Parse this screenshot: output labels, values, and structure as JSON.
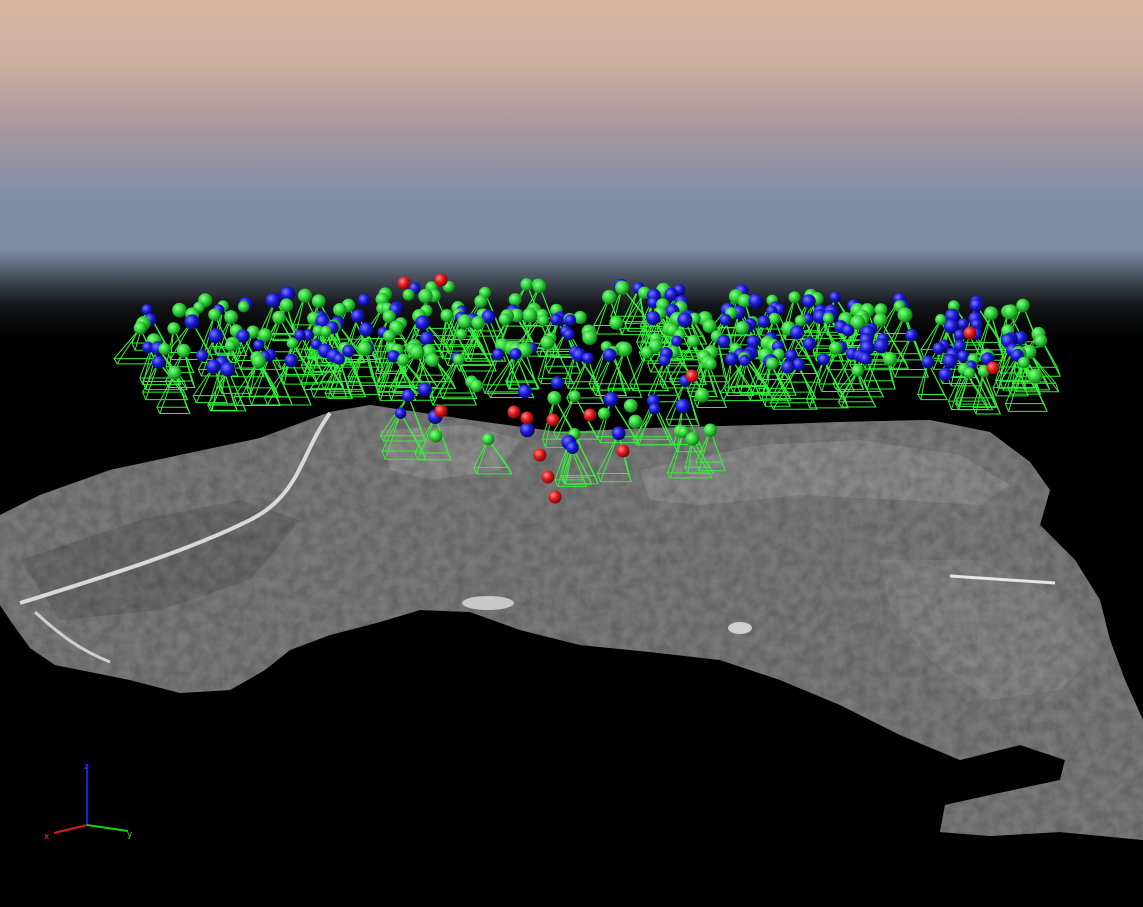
{
  "viewer": {
    "axes": {
      "x_label": "x",
      "y_label": "y",
      "z_label": "z"
    },
    "colors": {
      "camera_frustum": "#35f03a",
      "camera_center_green": "#2fd23a",
      "camera_center_blue": "#1a1ad8",
      "camera_center_red": "#e01818",
      "terrain": "#8a8a8a",
      "sky_top": "#d6b59f",
      "sky_mid": "#7f8ea8",
      "background": "#000000"
    }
  }
}
